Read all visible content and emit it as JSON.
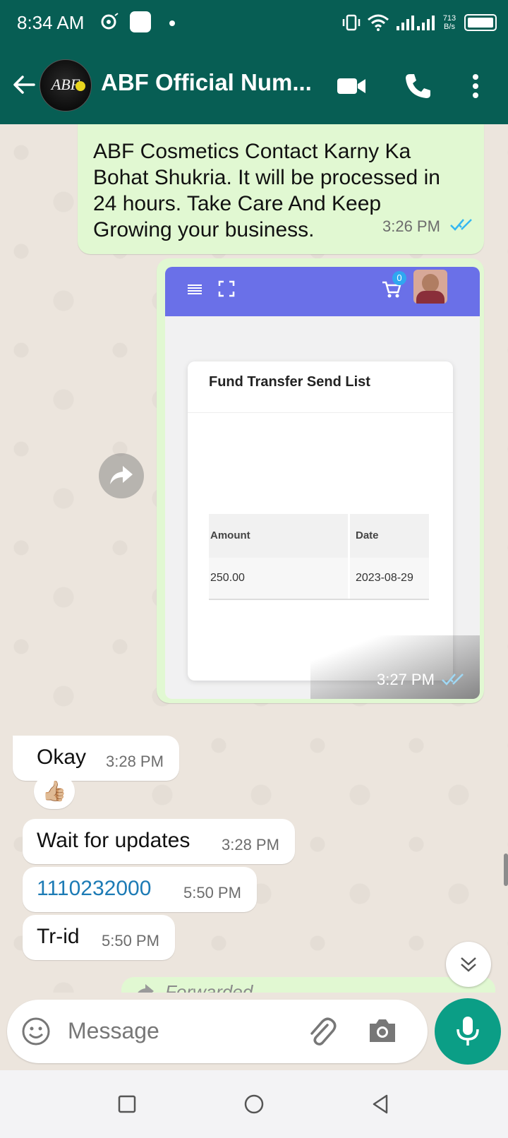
{
  "status_bar": {
    "time": "8:34 AM",
    "net_speed_value": "713",
    "net_speed_unit": "B/s",
    "icons": [
      "notification-icon",
      "app-icon",
      "vibrate-icon",
      "wifi-icon",
      "signal-icon",
      "battery-icon"
    ]
  },
  "header": {
    "avatar_text": "ABF",
    "contact_name": "ABF Official Num...",
    "icons": [
      "back-arrow-icon",
      "video-call-icon",
      "phone-icon",
      "more-vert-icon"
    ]
  },
  "messages": [
    {
      "direction": "outgoing",
      "text": "ABF Cosmetics Contact Karny Ka Bohat Shukria. It will be processed in 24 hours. Take Care And Keep Growing your business.",
      "time": "3:26 PM",
      "status": "read"
    },
    {
      "direction": "outgoing",
      "type": "image",
      "time": "3:27 PM",
      "status": "read",
      "image": {
        "cart_count": "0",
        "card_title": "Fund Transfer Send List",
        "table_headers": [
          "Amount",
          "Date"
        ],
        "table_rows": [
          [
            "250.00",
            "2023-08-29"
          ]
        ]
      }
    },
    {
      "direction": "incoming",
      "text": "Okay",
      "time": "3:28 PM",
      "reaction": "👍🏼"
    },
    {
      "direction": "incoming",
      "text": "Wait for updates",
      "time": "3:28 PM"
    },
    {
      "direction": "incoming",
      "text": "1110232000",
      "time": "5:50 PM",
      "is_link": true
    },
    {
      "direction": "incoming",
      "text": "Tr-id",
      "time": "5:50 PM"
    }
  ],
  "forwarded_label": "Forwarded",
  "composer": {
    "placeholder": "Message",
    "icons": [
      "emoji-icon",
      "attach-icon",
      "camera-icon",
      "mic-icon"
    ]
  },
  "colors": {
    "header_bg": "#075E54",
    "outgoing_bubble": "#E1F8D2",
    "incoming_bubble": "#FFFFFF",
    "chat_bg": "#ECE5DD",
    "read_ticks": "#34B7F1",
    "link": "#1D7BB5",
    "mic_button": "#0B9E86",
    "image_header": "#6A70E8"
  }
}
